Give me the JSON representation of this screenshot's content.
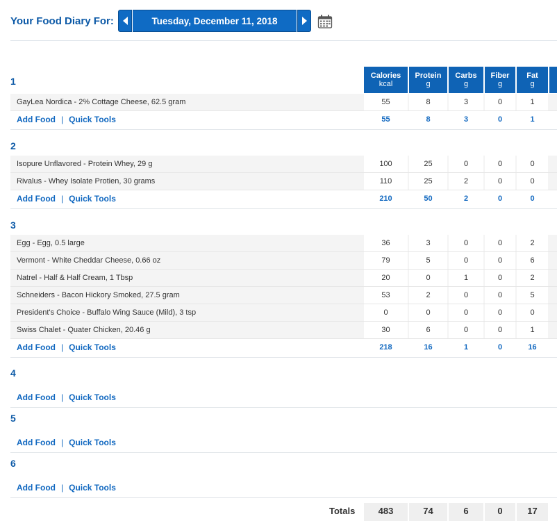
{
  "header": {
    "diary_label": "Your Food Diary For:",
    "date": "Tuesday, December 11, 2018",
    "icons": {
      "prev": "triangle-left-icon",
      "next": "triangle-right-icon",
      "calendar": "calendar-icon"
    }
  },
  "columns": [
    {
      "name": "Calories",
      "unit": "kcal"
    },
    {
      "name": "Protein",
      "unit": "g"
    },
    {
      "name": "Carbs",
      "unit": "g"
    },
    {
      "name": "Fiber",
      "unit": "g"
    },
    {
      "name": "Fat",
      "unit": "g"
    }
  ],
  "actions": {
    "add_food": "Add Food",
    "quick_tools": "Quick Tools",
    "separator": "|"
  },
  "meals": [
    {
      "title": "1",
      "items": [
        {
          "name": "GayLea Nordica - 2% Cottage Cheese, 62.5 gram",
          "values": [
            "55",
            "8",
            "3",
            "0",
            "1"
          ]
        }
      ],
      "totals": [
        "55",
        "8",
        "3",
        "0",
        "1"
      ]
    },
    {
      "title": "2",
      "items": [
        {
          "name": "Isopure Unflavored - Protein Whey, 29 g",
          "values": [
            "100",
            "25",
            "0",
            "0",
            "0"
          ]
        },
        {
          "name": "Rivalus - Whey Isolate Protien, 30 grams",
          "values": [
            "110",
            "25",
            "2",
            "0",
            "0"
          ]
        }
      ],
      "totals": [
        "210",
        "50",
        "2",
        "0",
        "0"
      ]
    },
    {
      "title": "3",
      "items": [
        {
          "name": "Egg - Egg, 0.5 large",
          "values": [
            "36",
            "3",
            "0",
            "0",
            "2"
          ]
        },
        {
          "name": "Vermont - White Cheddar Cheese, 0.66 oz",
          "values": [
            "79",
            "5",
            "0",
            "0",
            "6"
          ]
        },
        {
          "name": "Natrel - Half & Half Cream, 1 Tbsp",
          "values": [
            "20",
            "0",
            "1",
            "0",
            "2"
          ]
        },
        {
          "name": "Schneiders - Bacon Hickory Smoked, 27.5 gram",
          "values": [
            "53",
            "2",
            "0",
            "0",
            "5"
          ]
        },
        {
          "name": "President's Choice - Buffalo Wing Sauce (Mild), 3 tsp",
          "values": [
            "0",
            "0",
            "0",
            "0",
            "0"
          ]
        },
        {
          "name": "Swiss Chalet - Quater Chicken, 20.46 g",
          "values": [
            "30",
            "6",
            "0",
            "0",
            "1"
          ]
        }
      ],
      "totals": [
        "218",
        "16",
        "1",
        "0",
        "16"
      ]
    },
    {
      "title": "4",
      "items": [],
      "totals": null
    },
    {
      "title": "5",
      "items": [],
      "totals": null
    },
    {
      "title": "6",
      "items": [],
      "totals": null
    }
  ],
  "totals": {
    "label": "Totals",
    "values": [
      "483",
      "74",
      "6",
      "0",
      "17"
    ]
  },
  "colors": {
    "accent": "#0f63b5",
    "link": "#1168c0",
    "row_bg": "#f4f4f4"
  }
}
